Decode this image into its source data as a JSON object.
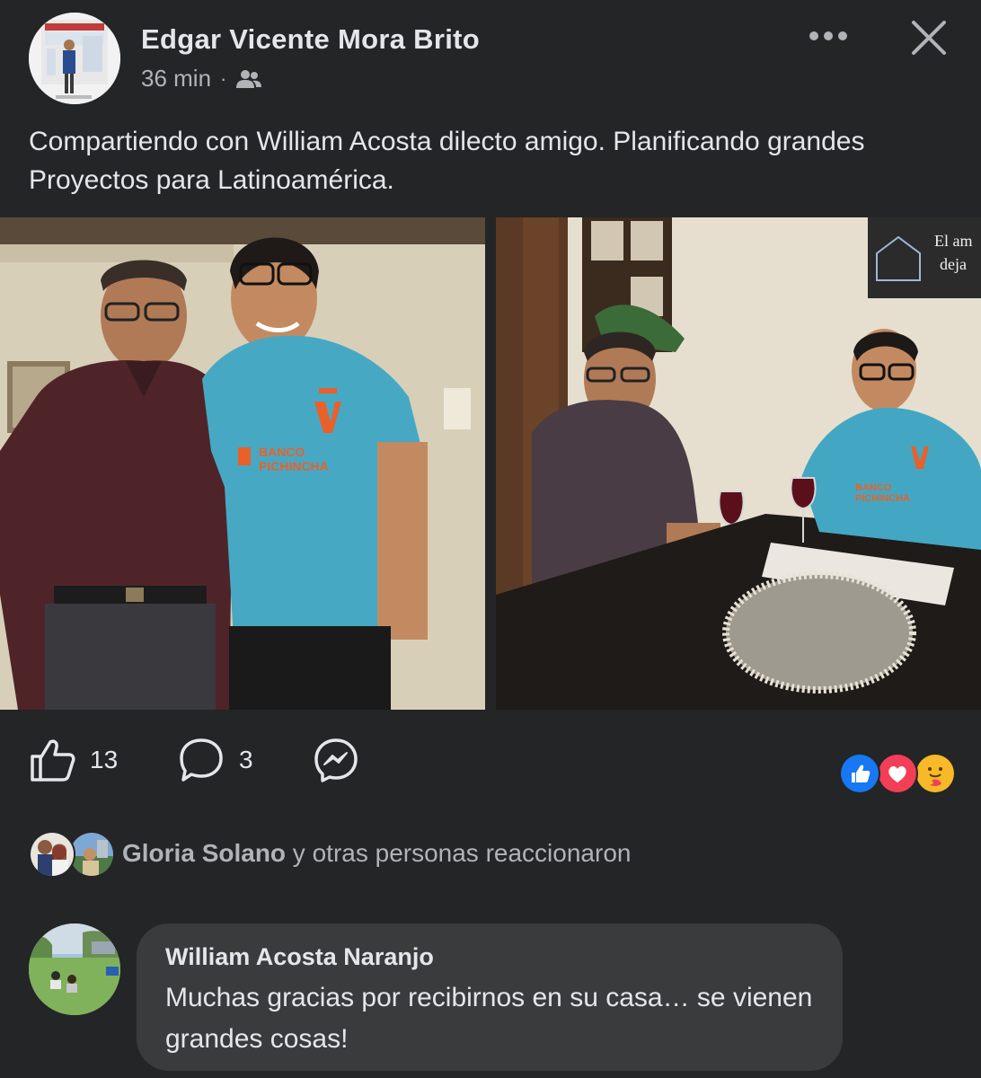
{
  "post": {
    "author_name": "Edgar Vicente Mora Brito",
    "time": "36 min",
    "separator": "·",
    "audience_icon": "friends-icon",
    "more_icon": "more-horizontal-icon",
    "close_icon": "close-icon",
    "text": "Compartiendo con William Acosta dilecto amigo. Planificando grandes Proyectos para Latinoamérica.",
    "photo_left_alt": "",
    "photo_right_sign_text_1": "El am",
    "photo_right_sign_text_2": "deja",
    "jersey_text_1": "BANCO",
    "jersey_text_2": "PICHINCHA",
    "jersey_logo": "U"
  },
  "actions": {
    "like_icon": "thumbs-up-icon",
    "like_count": "13",
    "comment_icon": "comment-bubble-icon",
    "comment_count": "3",
    "share_icon": "messenger-icon"
  },
  "reactions": [
    "like",
    "love",
    "care"
  ],
  "reactors": {
    "name": "Gloria Solano",
    "suffix": " y otras personas reaccionaron"
  },
  "comment": {
    "author": "William Acosta Naranjo",
    "text": "Muchas gracias por recibirnos en su casa… se vienen grandes cosas!"
  },
  "colors": {
    "background": "#242526",
    "bubble": "#3a3b3c",
    "text_primary": "#e4e6eb",
    "text_secondary": "#b0b3b8",
    "like_blue": "#1877f2",
    "love_red": "#f33e58",
    "care_yellow": "#f7b928"
  }
}
